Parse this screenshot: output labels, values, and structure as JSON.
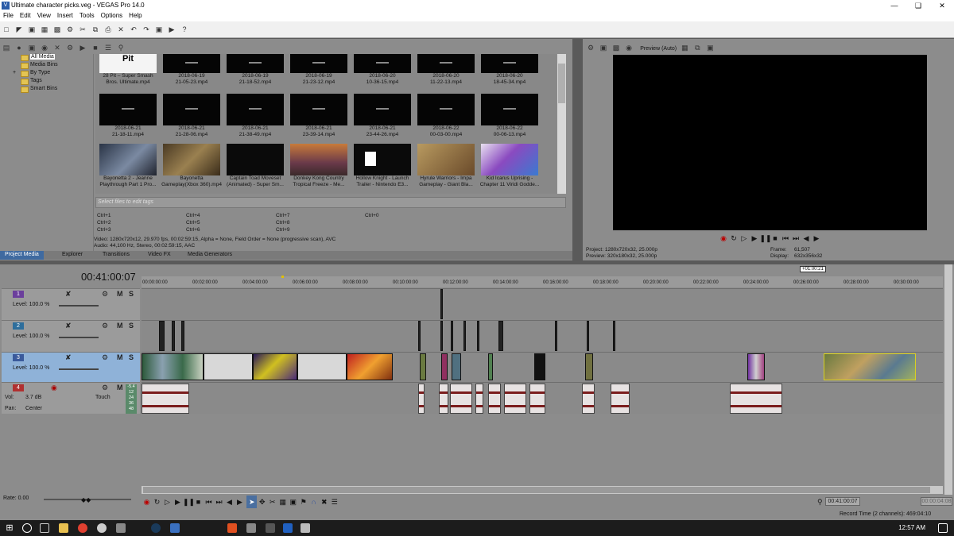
{
  "window": {
    "title": "Ultimate character picks.veg - VEGAS Pro 14.0"
  },
  "menu": [
    "File",
    "Edit",
    "View",
    "Insert",
    "Tools",
    "Options",
    "Help"
  ],
  "media_tree": [
    "All Media",
    "Media Bins",
    "By Type",
    "Tags",
    "Smart Bins"
  ],
  "media_files": [
    {
      "line1": "28 Pit – Super Smash",
      "line2": "Bros. Ultimate.mp4"
    },
    {
      "line1": "2018-06-19",
      "line2": "21-05-23.mp4"
    },
    {
      "line1": "2018-06-19",
      "line2": "21-18-52.mp4"
    },
    {
      "line1": "2018-06-19",
      "line2": "21-23-12.mp4"
    },
    {
      "line1": "2018-06-20",
      "line2": "10-36-15.mp4"
    },
    {
      "line1": "2018-06-20",
      "line2": "11-22-13.mp4"
    },
    {
      "line1": "2018-06-20",
      "line2": "18-45-34.mp4"
    },
    {
      "line1": "2018-06-21",
      "line2": "21-18-11.mp4"
    },
    {
      "line1": "2018-06-21",
      "line2": "21-28-06.mp4"
    },
    {
      "line1": "2018-06-21",
      "line2": "21-38-49.mp4"
    },
    {
      "line1": "2018-06-21",
      "line2": "23-39-14.mp4"
    },
    {
      "line1": "2018-06-21",
      "line2": "23-44-26.mp4"
    },
    {
      "line1": "2018-06-22",
      "line2": "00-03-00.mp4"
    },
    {
      "line1": "2018-06-22",
      "line2": "00-06-13.mp4"
    },
    {
      "line1": "Bayonetta 2 - Jeanne",
      "line2": "Playthrough Part 1 Pro..."
    },
    {
      "line1": "Bayonetta",
      "line2": "Gameplay(Xbox 360).mp4"
    },
    {
      "line1": "Captain Toad Moveset",
      "line2": "(Animated) - Super Sm..."
    },
    {
      "line1": "Donkey Kong Country",
      "line2": "Tropical Freeze - Me..."
    },
    {
      "line1": "Hollow Knight - Launch",
      "line2": "Trailer - Nintendo E3..."
    },
    {
      "line1": "Hyrule Warriors - Impa",
      "line2": "Gameplay - Giant Bla..."
    },
    {
      "line1": "Kid Icarus Uprising -",
      "line2": "Chapter 11 Viridi Godde..."
    }
  ],
  "tags_placeholder": "Select files to edit tags",
  "hotkeys": [
    "Ctrl+1",
    "Ctrl+2",
    "Ctrl+3",
    "Ctrl+4",
    "Ctrl+5",
    "Ctrl+6",
    "Ctrl+7",
    "Ctrl+8",
    "Ctrl+9",
    "Ctrl+0"
  ],
  "media_info": {
    "video": "Video: 1280x720x12, 29.970 fps, 00:02:59:15, Alpha = None, Field Order = None (progressive scan), AVC",
    "audio": "Audio: 44,100 Hz, Stereo, 00:02:59:15, AAC"
  },
  "tabs": [
    "Project Media",
    "Explorer",
    "Transitions",
    "Video FX",
    "Media Generators"
  ],
  "preview": {
    "mode": "Preview (Auto)",
    "project": "Project:   1280x720x32, 25.000p",
    "preview_res": "Preview:   320x180x32, 25.000p",
    "frame_label": "Frame:",
    "frame": "61,507",
    "display_label": "Display:",
    "display": "632x356x32"
  },
  "timeline": {
    "timecode": "00:41:00:07",
    "marker": "+01:00:21",
    "ruler": [
      "00:00:00:00",
      "00:02:00:00",
      "00:04:00:00",
      "00:06:00:00",
      "00:08:00:00",
      "00:10:00:00",
      "00:12:00:00",
      "00:14:00:00",
      "00:16:00:00",
      "00:18:00:00",
      "00:20:00:00",
      "00:22:00:00",
      "00:24:00:00",
      "00:26:00:00",
      "00:28:00:00",
      "00:30:00:00"
    ],
    "tracks": [
      {
        "num": "1",
        "level": "Level: 100.0 %",
        "color": "#6b3f9c"
      },
      {
        "num": "2",
        "level": "Level: 100.0 %",
        "color": "#2e6e9c"
      },
      {
        "num": "3",
        "level": "Level: 100.0 %",
        "color": "#3a5a9c"
      },
      {
        "num": "4",
        "vol": "Vol:",
        "vol_val": "3.7 dB",
        "pan": "Pan:",
        "pan_val": "Center",
        "mode": "Touch",
        "color": "#b03030"
      }
    ],
    "meter": [
      "-5.4",
      "12",
      "24",
      "36",
      "48"
    ],
    "rate": "Rate: 0.00",
    "pos": "00:41:00:07",
    "end": "00:00:04:08",
    "record": "Record Time (2 channels): 469:04:10"
  },
  "taskbar": {
    "time": "12:57 AM"
  }
}
